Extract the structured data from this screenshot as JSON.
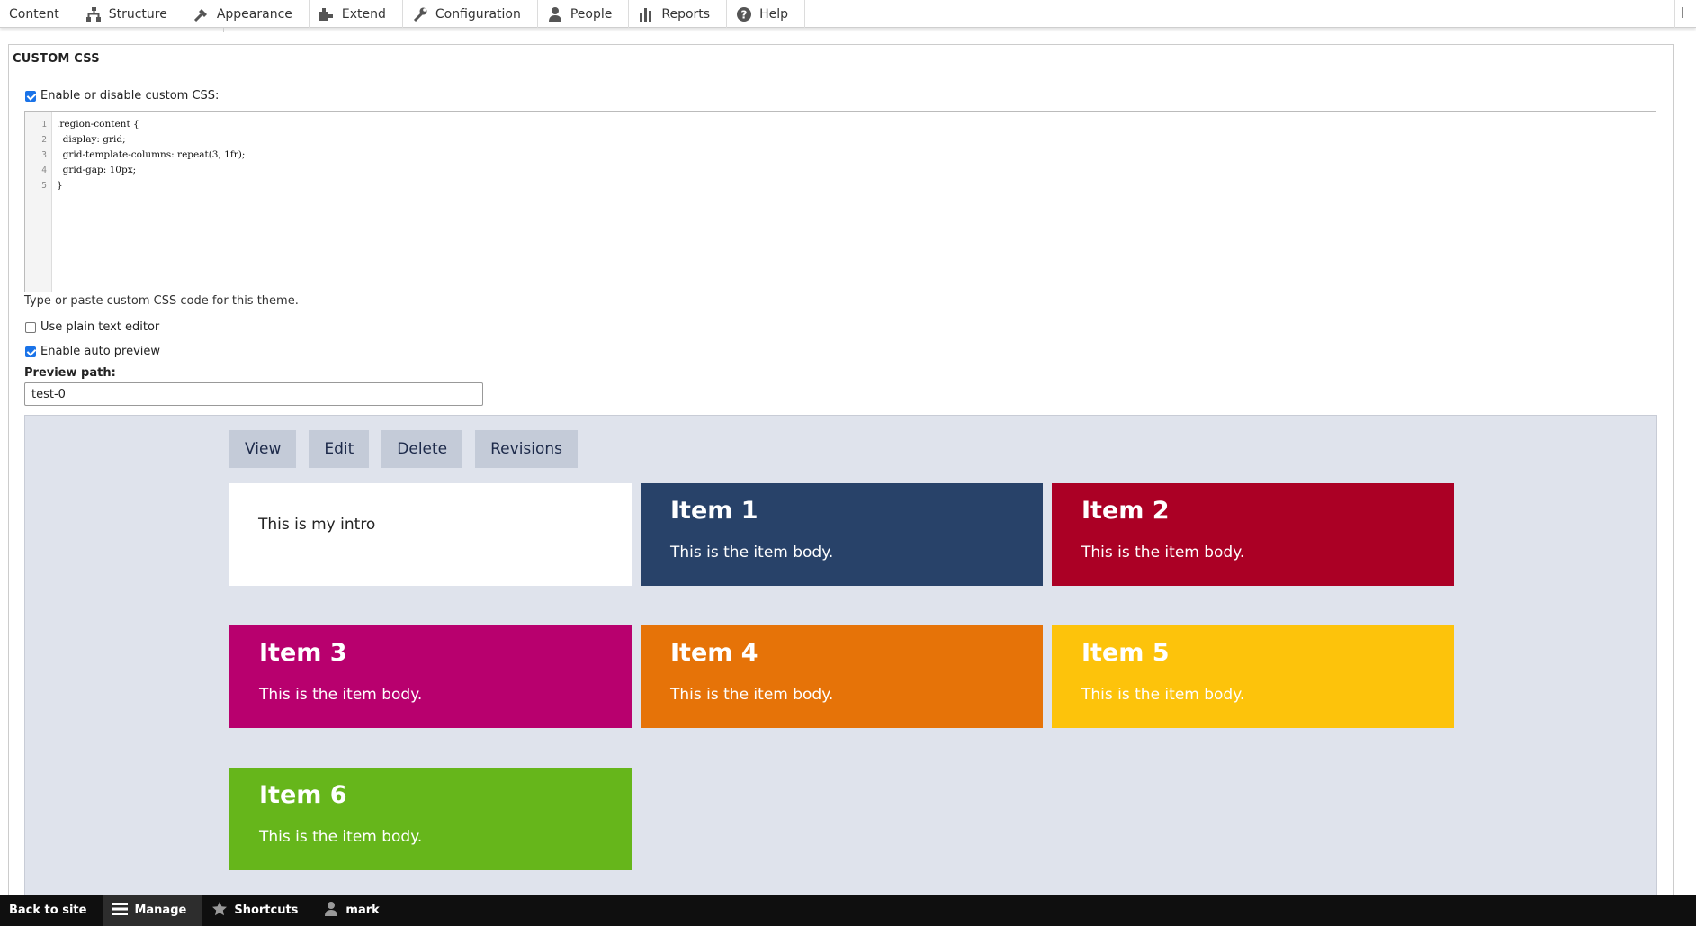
{
  "admin_menu": {
    "items": [
      {
        "label": "Content",
        "icon": "none"
      },
      {
        "label": "Structure",
        "icon": "structure-icon"
      },
      {
        "label": "Appearance",
        "icon": "appearance-icon"
      },
      {
        "label": "Extend",
        "icon": "extend-icon"
      },
      {
        "label": "Configuration",
        "icon": "wrench-icon"
      },
      {
        "label": "People",
        "icon": "people-icon"
      },
      {
        "label": "Reports",
        "icon": "reports-icon"
      },
      {
        "label": "Help",
        "icon": "help-icon"
      }
    ]
  },
  "form": {
    "legend": "CUSTOM CSS",
    "enable_label": "Enable or disable custom CSS:",
    "enable_checked": true,
    "code_lines": [
      {
        "n": "1",
        "text": ".region-content {"
      },
      {
        "n": "2",
        "text": "  display: grid;"
      },
      {
        "n": "3",
        "text": "  grid-template-columns: repeat(3, 1fr);"
      },
      {
        "n": "4",
        "text": "  grid-gap: 10px;"
      },
      {
        "n": "5",
        "text": "}"
      }
    ],
    "help_text": "Type or paste custom CSS code for this theme.",
    "plain_editor_label": "Use plain text editor",
    "plain_editor_checked": false,
    "auto_preview_label": "Enable auto preview",
    "auto_preview_checked": true,
    "preview_path_label": "Preview path:",
    "preview_path_value": "test-0"
  },
  "preview": {
    "tabs": [
      "View",
      "Edit",
      "Delete",
      "Revisions"
    ],
    "intro": "This is my intro",
    "items": [
      {
        "title": "Item 1",
        "body": "This is the item body.",
        "color": "#284269"
      },
      {
        "title": "Item 2",
        "body": "This is the item body.",
        "color": "#ab0025"
      },
      {
        "title": "Item 3",
        "body": "This is the item body.",
        "color": "#b8006e"
      },
      {
        "title": "Item 4",
        "body": "This is the item body.",
        "color": "#e67308"
      },
      {
        "title": "Item 5",
        "body": "This is the item body.",
        "color": "#fdc30b"
      },
      {
        "title": "Item 6",
        "body": "This is the item body.",
        "color": "#66b61b"
      }
    ]
  },
  "toolbar": {
    "back_label": "Back to site",
    "manage_label": "Manage",
    "shortcuts_label": "Shortcuts",
    "user_label": "mark"
  }
}
